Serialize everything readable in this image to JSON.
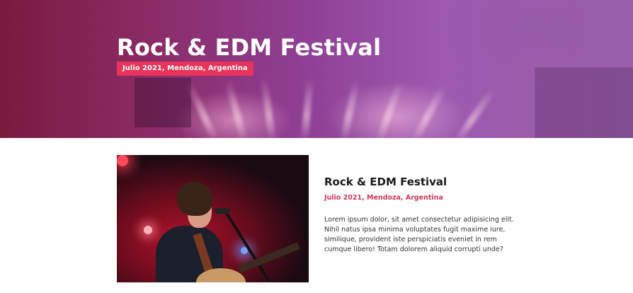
{
  "hero": {
    "title": "Rock & EDM Festival",
    "badge": "Julio 2021, Mendoza, Argentina"
  },
  "event": {
    "image_alt": "Guitarist singing into a microphone on stage",
    "title": "Rock & EDM Festival",
    "meta": "Julio 2021, Mendoza, Argentina",
    "description": "Lorem ipsum dolor, sit amet consectetur adipisicing elit. Nihil natus ipsa minima voluptates fugit maxime iure, similique, provident iste perspiciatis eveniet in rem cumque libero! Totam dolorem aliquid corrupti unde?"
  },
  "colors": {
    "accent": "#e8335a",
    "meta_text": "#d2365a",
    "hero_overlay": "#8f3f95"
  }
}
